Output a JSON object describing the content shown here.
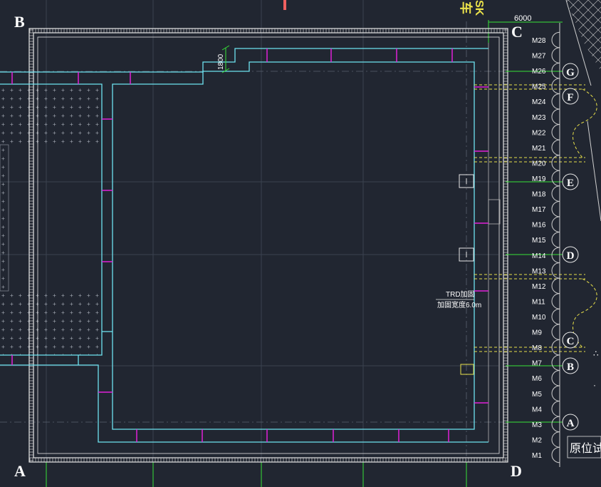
{
  "drawing": {
    "corners": {
      "a": "A",
      "b": "B",
      "c": "C",
      "d": "D"
    },
    "top_right": {
      "char": "车",
      "code": "SK"
    },
    "dimensions": {
      "top": "6000",
      "offset": "1800"
    },
    "trd_note": {
      "line1": "TRD加固",
      "line2": "加固宽度6.0m"
    },
    "bottom_right_note": "原位试",
    "well_labels": [
      "M28",
      "M27",
      "M26",
      "M25",
      "M24",
      "M23",
      "M22",
      "M21",
      "M20",
      "M19",
      "M18",
      "M17",
      "M16",
      "M15",
      "M14",
      "M13",
      "M12",
      "M11",
      "M10",
      "M9",
      "M8",
      "M7",
      "M6",
      "M5",
      "M4",
      "M3",
      "M2",
      "M1"
    ],
    "axis_labels": [
      "G",
      "F",
      "E",
      "D",
      "C",
      "B",
      "A"
    ],
    "colors": {
      "background": "#212631",
      "boundary": "#e6e6e6",
      "cyan": "#6ee3f0",
      "magenta": "#e020d8",
      "grid": "#3a4250",
      "yellow": "#e8e04a",
      "green": "#37e237",
      "red": "#f06060"
    }
  }
}
